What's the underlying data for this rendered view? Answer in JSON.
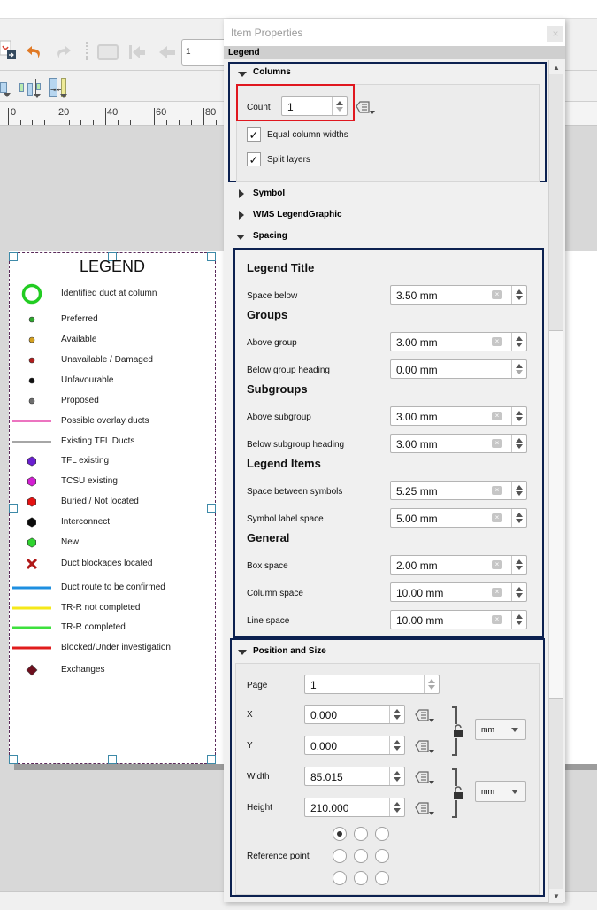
{
  "toolbar": {
    "feature_number": "1",
    "icons": [
      "export-pdf-icon",
      "undo-icon",
      "redo-icon",
      "atlas-preview-icon",
      "first-feature-icon",
      "previous-feature-icon",
      "align-icon",
      "distribute-icon",
      "resize-icon"
    ]
  },
  "ruler": {
    "ticks": [
      "0",
      "20",
      "40",
      "60",
      "80"
    ]
  },
  "legend": {
    "title": "LEGEND",
    "items": [
      {
        "label": "Identified duct at column",
        "symbol": "ring",
        "color": "#22cc22"
      },
      {
        "label": "Preferred",
        "symbol": "dot",
        "color": "#2ea82e"
      },
      {
        "label": "Available",
        "symbol": "dot",
        "color": "#d4a020"
      },
      {
        "label": "Unavailable / Damaged",
        "symbol": "dot",
        "color": "#b01c1c"
      },
      {
        "label": "Unfavourable",
        "symbol": "dot",
        "color": "#111111"
      },
      {
        "label": "Proposed",
        "symbol": "dot",
        "color": "#6e6e6e"
      },
      {
        "label": "Possible overlay ducts",
        "symbol": "line-thin",
        "color": "#e0209a"
      },
      {
        "label": "Existing TFL Ducts",
        "symbol": "line-thin",
        "color": "#707070"
      },
      {
        "label": "TFL existing",
        "symbol": "hex",
        "color": "#6a1fd0"
      },
      {
        "label": "TCSU existing",
        "symbol": "hex",
        "color": "#d21ed2"
      },
      {
        "label": "Buried / Not located",
        "symbol": "hex",
        "color": "#e41212"
      },
      {
        "label": "Interconnect",
        "symbol": "hex",
        "color": "#0a0a0a"
      },
      {
        "label": "New",
        "symbol": "hex",
        "color": "#2fd42f"
      },
      {
        "label": "Duct blockages located",
        "symbol": "cross",
        "color": "#b01818"
      },
      {
        "label": "Duct route to be confirmed",
        "symbol": "line-thick",
        "color": "#1e8fe0"
      },
      {
        "label": "TR-R not completed",
        "symbol": "line-thick",
        "color": "#f5e81a"
      },
      {
        "label": "TR-R completed",
        "symbol": "line-thick",
        "color": "#3ee03e"
      },
      {
        "label": "Blocked/Under investigation",
        "symbol": "line-thick",
        "color": "#e01c1c"
      },
      {
        "label": "Exchanges",
        "symbol": "diamond",
        "color": "#6e0f1e"
      }
    ]
  },
  "dialog": {
    "title": "Item Properties",
    "item_type": "Legend",
    "close_label": "×",
    "columns": {
      "header": "Columns",
      "expanded": true,
      "count_label": "Count",
      "count_value": "1",
      "equal_widths_label": "Equal column widths",
      "equal_widths_checked": true,
      "split_layers_label": "Split layers",
      "split_layers_checked": true
    },
    "symbol": {
      "header": "Symbol",
      "expanded": false
    },
    "wms": {
      "header": "WMS LegendGraphic",
      "expanded": false
    },
    "spacing": {
      "header": "Spacing",
      "expanded": true,
      "groups": [
        {
          "title": "Legend Title",
          "fields": [
            {
              "label": "Space below",
              "value": "3.50 mm",
              "clearable": true
            }
          ]
        },
        {
          "title": "Groups",
          "fields": [
            {
              "label": "Above group",
              "value": "3.00 mm",
              "clearable": true
            },
            {
              "label": "Below group heading",
              "value": "0.00 mm",
              "clearable": false
            }
          ]
        },
        {
          "title": "Subgroups",
          "fields": [
            {
              "label": "Above subgroup",
              "value": "3.00 mm",
              "clearable": true
            },
            {
              "label": "Below subgroup heading",
              "value": "3.00 mm",
              "clearable": true
            }
          ]
        },
        {
          "title": "Legend Items",
          "fields": [
            {
              "label": "Space between symbols",
              "value": "5.25 mm",
              "clearable": true
            },
            {
              "label": "Symbol label space",
              "value": "5.00 mm",
              "clearable": true
            }
          ]
        },
        {
          "title": "General",
          "fields": [
            {
              "label": "Box space",
              "value": "2.00 mm",
              "clearable": true
            },
            {
              "label": "Column space",
              "value": "10.00 mm",
              "clearable": true
            },
            {
              "label": "Line space",
              "value": "10.00 mm",
              "clearable": true
            }
          ]
        }
      ]
    },
    "position": {
      "header": "Position and Size",
      "expanded": true,
      "page_label": "Page",
      "page_value": "1",
      "x_label": "X",
      "x_value": "0.000",
      "y_label": "Y",
      "y_value": "0.000",
      "width_label": "Width",
      "width_value": "85.015",
      "height_label": "Height",
      "height_value": "210.000",
      "position_unit": "mm",
      "size_unit": "mm",
      "reference_label": "Reference point",
      "reference_selected": "top-left"
    }
  }
}
